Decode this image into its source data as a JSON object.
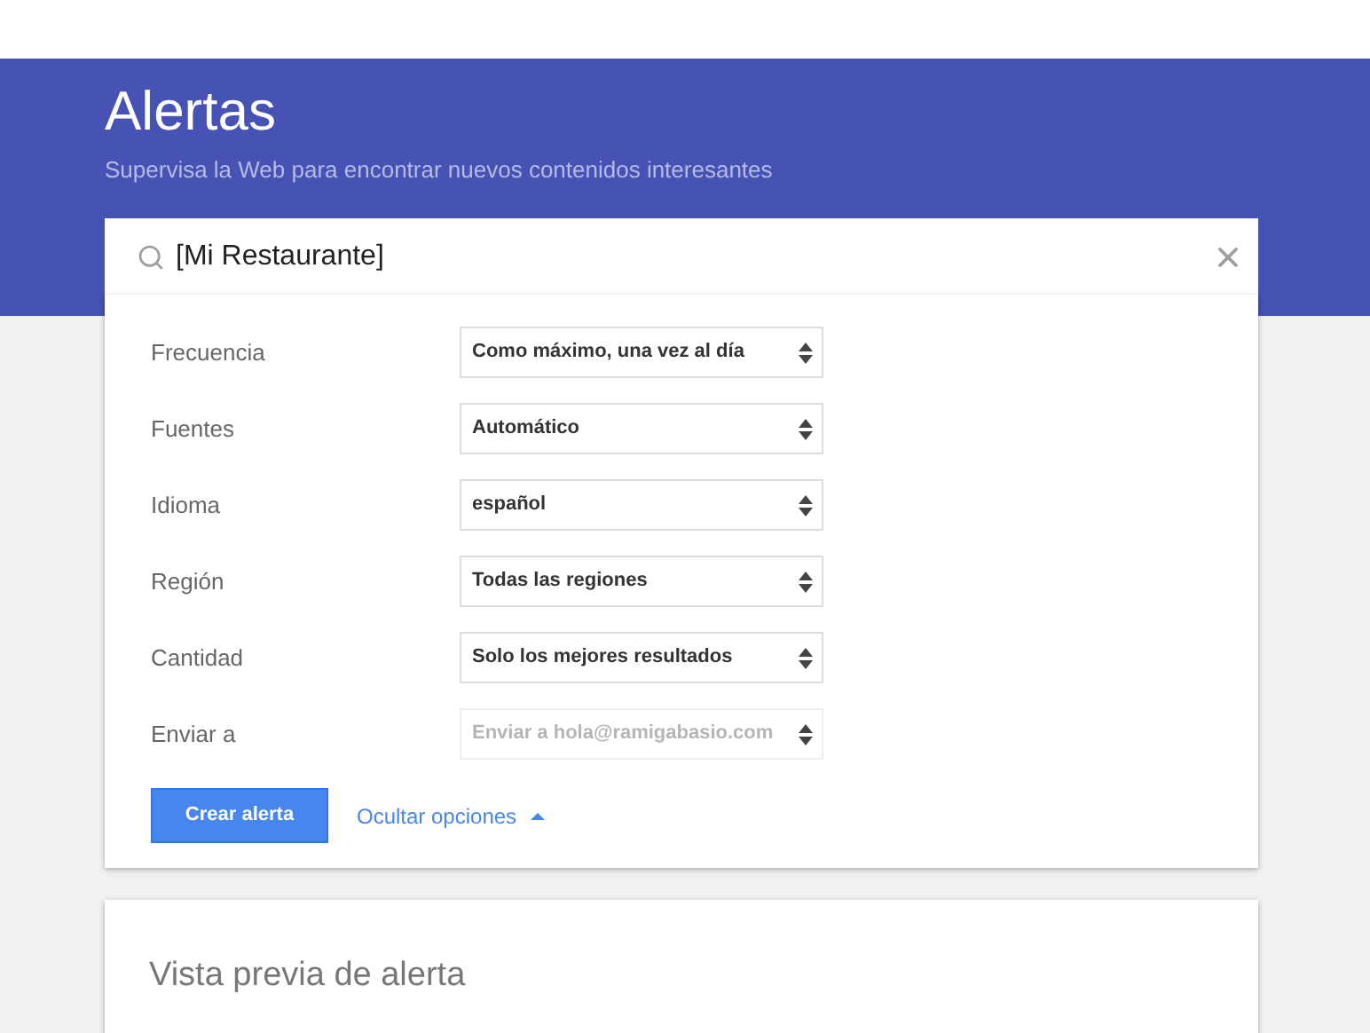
{
  "header": {
    "title": "Alertas",
    "subtitle": "Supervisa la Web para encontrar nuevos contenidos interesantes"
  },
  "search": {
    "value": "[Mi Restaurante]"
  },
  "options": [
    {
      "label": "Frecuencia",
      "value": "Como máximo, una vez al día"
    },
    {
      "label": "Fuentes",
      "value": "Automático"
    },
    {
      "label": "Idioma",
      "value": "español"
    },
    {
      "label": "Región",
      "value": "Todas las regiones"
    },
    {
      "label": "Cantidad",
      "value": "Solo los mejores resultados"
    },
    {
      "label": "Enviar a",
      "placeholder": "Enviar a hola@ramigabasio.com"
    }
  ],
  "create_button": "Crear alerta",
  "toggle_link": {
    "label": "Ocultar opciones",
    "expanded": true
  },
  "preview": {
    "title": "Vista previa de alerta"
  }
}
